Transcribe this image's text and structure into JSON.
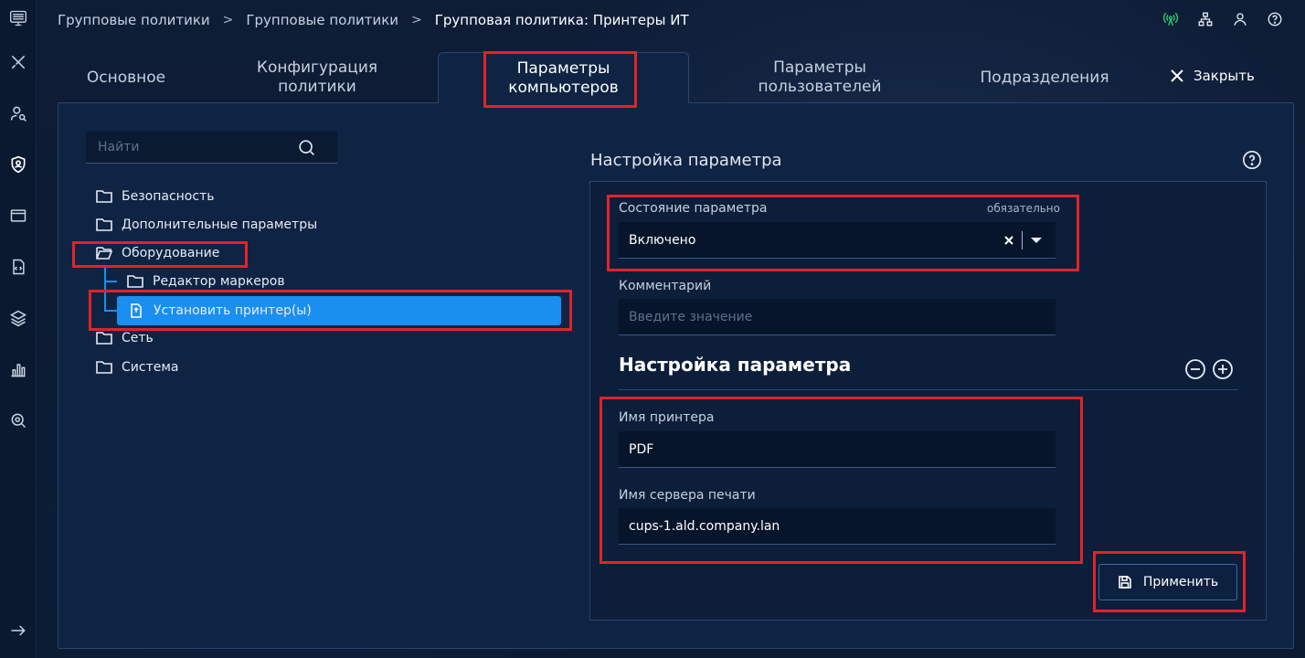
{
  "breadcrumb": {
    "items": [
      "Групповые политики",
      "Групповые политики",
      "Групповая политика: Принтеры ИТ"
    ],
    "separator": ">"
  },
  "tabs": [
    {
      "label": "Основное"
    },
    {
      "label": "Конфигурация политики"
    },
    {
      "label": "Параметры компьютеров"
    },
    {
      "label": "Параметры пользователей"
    },
    {
      "label": "Подразделения"
    }
  ],
  "close_label": "Закрыть",
  "search": {
    "placeholder": "Найти"
  },
  "tree": {
    "security": "Безопасность",
    "additional": "Дополнительные параметры",
    "hardware": "Оборудование",
    "token_editor": "Редактор маркеров",
    "install_printer": "Установить принтер(ы)",
    "network": "Сеть",
    "system": "Система"
  },
  "setting": {
    "title": "Настройка параметра",
    "state_label": "Состояние параметра",
    "required": "обязательно",
    "state_value": "Включено",
    "comment_label": "Комментарий",
    "comment_placeholder": "Введите значение",
    "sub_title": "Настройка параметра",
    "printer_name_label": "Имя принтера",
    "printer_name_value": "PDF",
    "print_server_label": "Имя сервера печати",
    "print_server_value": "cups-1.ald.company.lan",
    "apply_label": "Применить"
  },
  "colors": {
    "accent": "#1a8ff0",
    "highlight": "#e2222b",
    "status_ok": "#2ecc71"
  }
}
